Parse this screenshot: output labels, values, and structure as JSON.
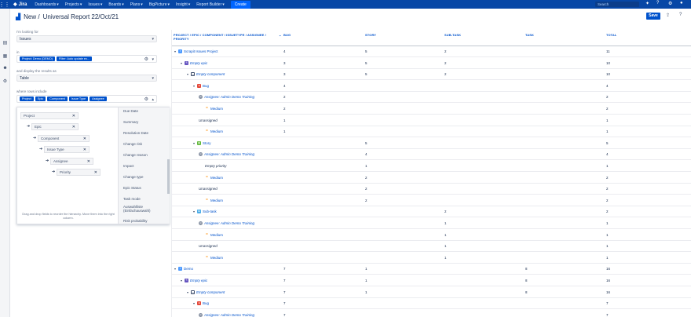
{
  "topnav": {
    "product": "Jira",
    "menus": [
      "Dashboards",
      "Projects",
      "Issues",
      "Boards",
      "Plans",
      "BigPicture",
      "Insight",
      "Report Builder"
    ],
    "create_label": "Create",
    "search_placeholder": "Search"
  },
  "header": {
    "breadcrumb": "New /",
    "title": "Universal Report 22/Oct/21",
    "save_label": "Save"
  },
  "config": {
    "looking_for_label": "I'm looking for",
    "looking_for_value": "Issues",
    "in_label": "in",
    "in_chips": [
      "Project: Demo (DEMO)",
      "Filter: Auto update ex..."
    ],
    "display_label": "and display the results as",
    "display_value": "Table",
    "group_label": "where rows include",
    "group_chips": [
      "Project",
      "Epic",
      "Component",
      "Issue Type",
      "Assignee"
    ]
  },
  "tree": {
    "items": [
      "Project",
      "Epic",
      "Component",
      "Issue Type",
      "Assignee",
      "Priority"
    ],
    "hint": "Drag and drop fields to reorder the hierarchy. Move them into the right column."
  },
  "fields": [
    "Due Date",
    "Summary",
    "Resolution Date",
    "Change risk",
    "Change reason",
    "Impact",
    "Change type",
    "Epic Status",
    "Task mode",
    "Auswahlliste (Einfachauswahl)",
    "Risk probability"
  ],
  "table": {
    "headers": [
      "PROJECT / EPIC / COMPONENT / ISSUETYPE / ASSIGNEE / PRIORITY",
      "BUG",
      "STORY",
      "SUB-TASK",
      "TASK",
      "TOTAL"
    ],
    "rows": [
      {
        "name": "Scrapit Issues Project",
        "icon": "proj",
        "bug": "4",
        "story": "5",
        "sub": "2",
        "task": "",
        "total": "11"
      },
      {
        "name": "Empty epic",
        "icon": "epic",
        "bug": "3",
        "story": "5",
        "sub": "2",
        "task": "",
        "total": "10"
      },
      {
        "name": "Empty component",
        "icon": "comp",
        "bug": "3",
        "story": "5",
        "sub": "2",
        "task": "",
        "total": "10"
      },
      {
        "name": "Bug",
        "icon": "bug",
        "bug": "4",
        "story": "",
        "sub": "",
        "task": "",
        "total": "4"
      },
      {
        "name": "Assignee: Admin Demo Training",
        "icon": "user",
        "bug": "2",
        "story": "",
        "sub": "",
        "task": "",
        "total": "2"
      },
      {
        "name": "Medium",
        "icon": "prio",
        "bug": "2",
        "story": "",
        "sub": "",
        "task": "",
        "total": "2"
      },
      {
        "name": "Unassigned",
        "icon": "none",
        "bug": "1",
        "story": "",
        "sub": "",
        "task": "",
        "total": "1"
      },
      {
        "name": "Medium",
        "icon": "prio",
        "bug": "1",
        "story": "",
        "sub": "",
        "task": "",
        "total": "1"
      },
      {
        "name": "Story",
        "icon": "story",
        "bug": "",
        "story": "5",
        "sub": "",
        "task": "",
        "total": "5"
      },
      {
        "name": "Assignee: Admin Demo Training",
        "icon": "user",
        "bug": "",
        "story": "4",
        "sub": "",
        "task": "",
        "total": "4"
      },
      {
        "name": "Empty priority",
        "icon": "none",
        "bug": "",
        "story": "1",
        "sub": "",
        "task": "",
        "total": "1"
      },
      {
        "name": "Medium",
        "icon": "prio",
        "bug": "",
        "story": "2",
        "sub": "",
        "task": "",
        "total": "2"
      },
      {
        "name": "Unassigned",
        "icon": "none",
        "bug": "",
        "story": "2",
        "sub": "",
        "task": "",
        "total": "2"
      },
      {
        "name": "Medium",
        "icon": "prio",
        "bug": "",
        "story": "2",
        "sub": "",
        "task": "",
        "total": "2"
      },
      {
        "name": "Sub-task",
        "icon": "sub",
        "bug": "",
        "story": "",
        "sub": "2",
        "task": "",
        "total": "2"
      },
      {
        "name": "Assignee: Admin Demo Training",
        "icon": "user",
        "bug": "",
        "story": "",
        "sub": "1",
        "task": "",
        "total": "1"
      },
      {
        "name": "Medium",
        "icon": "prio",
        "bug": "",
        "story": "",
        "sub": "1",
        "task": "",
        "total": "1"
      },
      {
        "name": "Unassigned",
        "icon": "none",
        "bug": "",
        "story": "",
        "sub": "1",
        "task": "",
        "total": "1"
      },
      {
        "name": "Medium",
        "icon": "prio",
        "bug": "",
        "story": "",
        "sub": "1",
        "task": "",
        "total": "1"
      },
      {
        "name": "Demo",
        "icon": "proj",
        "bug": "7",
        "story": "1",
        "sub": "",
        "task": "8",
        "total": "16"
      },
      {
        "name": "Empty epic",
        "icon": "epic",
        "bug": "7",
        "story": "1",
        "sub": "",
        "task": "8",
        "total": "16"
      },
      {
        "name": "Empty component",
        "icon": "comp",
        "bug": "7",
        "story": "1",
        "sub": "",
        "task": "8",
        "total": "16"
      },
      {
        "name": "Bug",
        "icon": "bug",
        "bug": "7",
        "story": "",
        "sub": "",
        "task": "",
        "total": "7"
      },
      {
        "name": "Assignee: Admin Demo Training",
        "icon": "user",
        "bug": "7",
        "story": "",
        "sub": "",
        "task": "",
        "total": "7"
      }
    ]
  }
}
